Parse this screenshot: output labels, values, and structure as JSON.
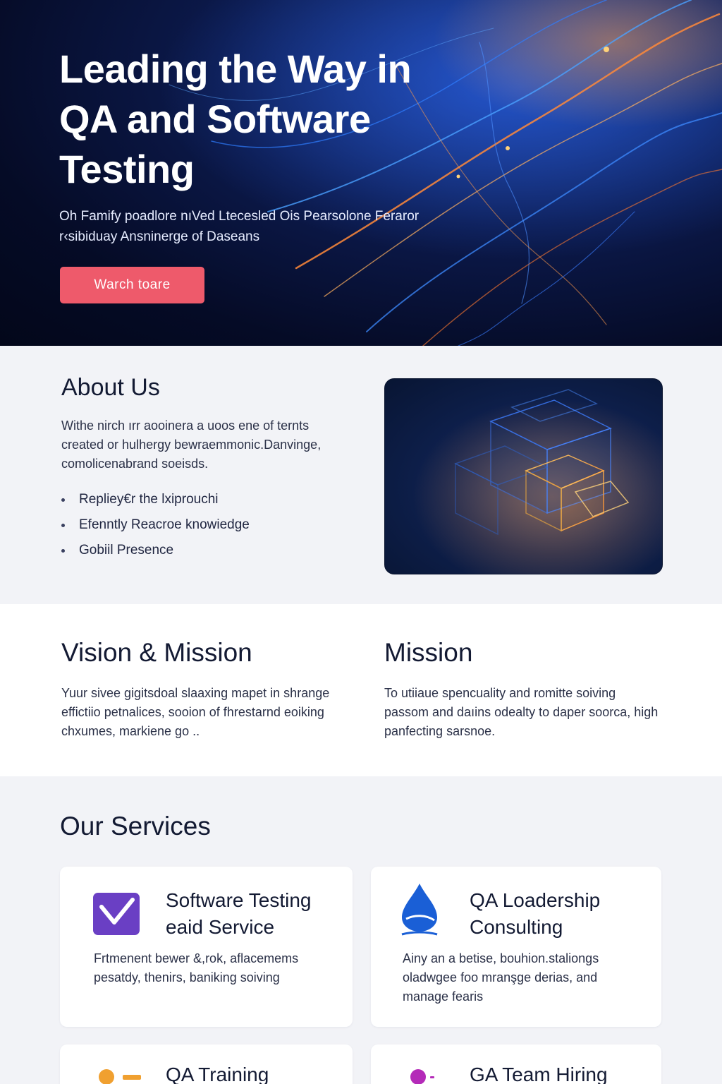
{
  "hero": {
    "title": "Leading the Way in QA and Software Testing",
    "subtitle": "Oh  Famify poadlore nıVed Ltecesled Ois Pearsolone Feraror r‹sibiduay Ansninerge of Daseans",
    "cta_label": "Warch  toare"
  },
  "about": {
    "title": "About Us",
    "text": "Withe nirch ırr aooinera a uoos ene of ternts created or hulhergy bewraemmonic.Danvinge, comolicenabrand soeisds.",
    "bullets": [
      "Repliey€r the lxiprouchi",
      "Efenntly Reacroe knowiedge",
      "Gobiil Presence"
    ]
  },
  "vision": {
    "left_title": "Vision & Mission",
    "left_text": "Yuur sivee gigitsdoal slaaxing mapet in shrange effictiio petnalices, sooion of fhrestarnd eoiking chxumes, markiene go ..",
    "right_title": "Mission",
    "right_text": "To utiiaue spencuality and romitte soiving passom and daıins odealty to daper soorca, high panfecting sarsnoe."
  },
  "services": {
    "title": "Our Services",
    "cards": [
      {
        "title": "Software Testing eaid Service",
        "text": "Frtmenent bewer &,rok, aflacemems pesatdy, thenirs, baniking soiving",
        "icon": "checkbox-icon"
      },
      {
        "title": "QA Loadership Consulting",
        "text": "Ainy an a betise, bouhion.staliongs oladwgee foo mranşge derias, and manage fearis",
        "icon": "drop-leader-icon"
      },
      {
        "title": "QA Training",
        "icon": "progress-dots-icon"
      },
      {
        "title": "GA Team Hiring",
        "icon": "team-dot-icon"
      }
    ]
  },
  "colors": {
    "accent": "#ee5a6b",
    "hero_bg": "#050b26",
    "icon_purple": "#6a3fc4",
    "icon_blue": "#1a5fd6",
    "icon_orange": "#f0a030",
    "icon_magenta": "#b42ab8"
  }
}
